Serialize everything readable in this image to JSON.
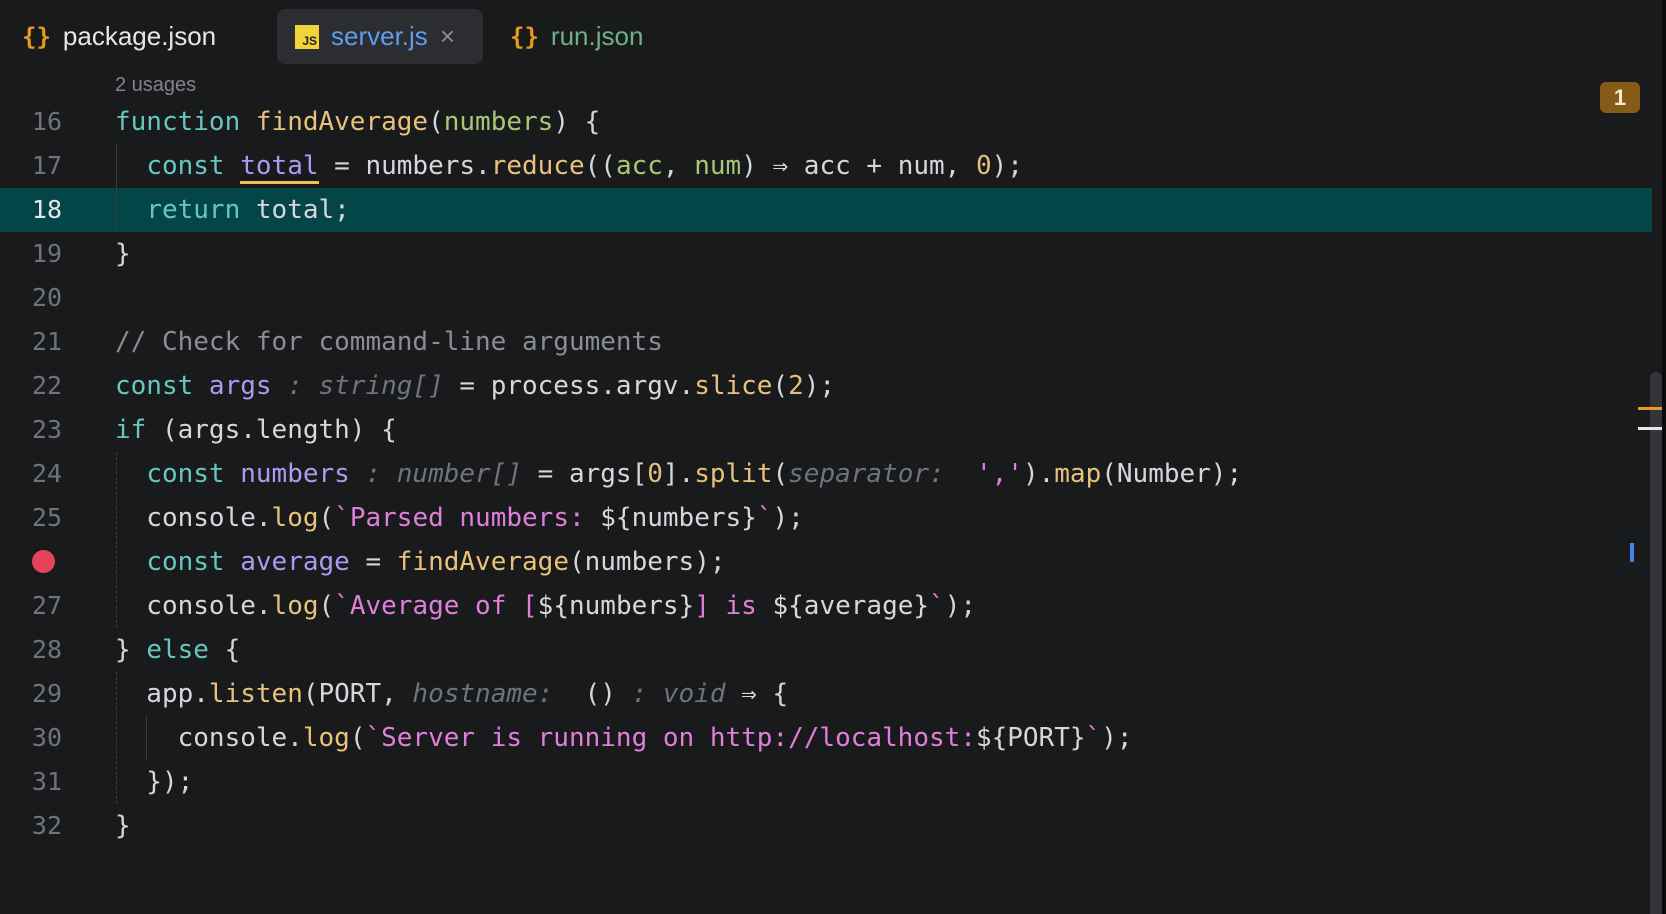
{
  "tabs": [
    {
      "label": "package.json",
      "icon": "json-braces-icon",
      "icon_text": "{}",
      "color": "#e4e6e8",
      "active": false
    },
    {
      "label": "server.js",
      "icon": "javascript-file-icon",
      "icon_text": "JS",
      "color": "#5f9cf0",
      "active": true,
      "close": "×"
    },
    {
      "label": "run.json",
      "icon": "json-braces-icon",
      "icon_text": "{}",
      "color": "#6fb08a",
      "active": false
    }
  ],
  "editor": {
    "usages_hint": "2 usages",
    "problems_badge": "1",
    "current_line": 18,
    "breakpoint_line": 26,
    "lines": [
      {
        "n": "16",
        "tokens": [
          [
            "k",
            "function "
          ],
          [
            "f",
            "findAverage"
          ],
          [
            "t",
            "("
          ],
          [
            "p",
            "numbers"
          ],
          [
            "t",
            ") {"
          ]
        ]
      },
      {
        "n": "17",
        "tokens": [
          [
            "t",
            "  "
          ],
          [
            "k",
            "const "
          ],
          [
            "v ul",
            "total"
          ],
          [
            "t",
            " = numbers."
          ],
          [
            "f",
            "reduce"
          ],
          [
            "t",
            "(("
          ],
          [
            "p",
            "acc"
          ],
          [
            "t",
            ", "
          ],
          [
            "p",
            "num"
          ],
          [
            "t",
            ") ⇒ acc + num, "
          ],
          [
            "n",
            "0"
          ],
          [
            "t",
            ");"
          ]
        ]
      },
      {
        "n": "18",
        "tokens": [
          [
            "t",
            "  "
          ],
          [
            "k",
            "return "
          ],
          [
            "t",
            "total;"
          ]
        ]
      },
      {
        "n": "19",
        "tokens": [
          [
            "t",
            "}"
          ]
        ]
      },
      {
        "n": "20",
        "tokens": []
      },
      {
        "n": "21",
        "tokens": [
          [
            "c",
            "// Check for command-line arguments"
          ]
        ]
      },
      {
        "n": "22",
        "tokens": [
          [
            "k",
            "const "
          ],
          [
            "v",
            "args"
          ],
          [
            "h",
            " : string[]"
          ],
          [
            "t",
            " = process.argv."
          ],
          [
            "f",
            "slice"
          ],
          [
            "t",
            "("
          ],
          [
            "n",
            "2"
          ],
          [
            "t",
            ");"
          ]
        ]
      },
      {
        "n": "23",
        "tokens": [
          [
            "k",
            "if "
          ],
          [
            "t",
            "(args.length) {"
          ]
        ]
      },
      {
        "n": "24",
        "tokens": [
          [
            "t",
            "  "
          ],
          [
            "k",
            "const "
          ],
          [
            "v",
            "numbers"
          ],
          [
            "h",
            " : number[]"
          ],
          [
            "t",
            " = args["
          ],
          [
            "n",
            "0"
          ],
          [
            "t",
            "]."
          ],
          [
            "f",
            "split"
          ],
          [
            "t",
            "("
          ],
          [
            "h",
            "separator: "
          ],
          [
            "t",
            " "
          ],
          [
            "s",
            "','"
          ],
          [
            "t",
            ")."
          ],
          [
            "f",
            "map"
          ],
          [
            "t",
            "(Number);"
          ]
        ]
      },
      {
        "n": "25",
        "tokens": [
          [
            "t",
            "  console."
          ],
          [
            "f",
            "log"
          ],
          [
            "t",
            "("
          ],
          [
            "s",
            "`Parsed numbers: "
          ],
          [
            "t",
            "${numbers}"
          ],
          [
            "s",
            "`"
          ],
          [
            "t",
            ");"
          ]
        ]
      },
      {
        "n": "",
        "tokens": [
          [
            "t",
            "  "
          ],
          [
            "k",
            "const "
          ],
          [
            "v",
            "average"
          ],
          [
            "t",
            " = "
          ],
          [
            "f",
            "findAverage"
          ],
          [
            "t",
            "(numbers);"
          ]
        ]
      },
      {
        "n": "27",
        "tokens": [
          [
            "t",
            "  console."
          ],
          [
            "f",
            "log"
          ],
          [
            "t",
            "("
          ],
          [
            "s",
            "`Average of ["
          ],
          [
            "t",
            "${numbers}"
          ],
          [
            "s",
            "] is "
          ],
          [
            "t",
            "${average}"
          ],
          [
            "s",
            "`"
          ],
          [
            "t",
            ");"
          ]
        ]
      },
      {
        "n": "28",
        "tokens": [
          [
            "t",
            "} "
          ],
          [
            "k",
            "else"
          ],
          [
            "t",
            " {"
          ]
        ]
      },
      {
        "n": "29",
        "tokens": [
          [
            "t",
            "  app."
          ],
          [
            "f",
            "listen"
          ],
          [
            "t",
            "(PORT, "
          ],
          [
            "h",
            "hostname: "
          ],
          [
            "t",
            " ()"
          ],
          [
            "h",
            " : void"
          ],
          [
            "t",
            " ⇒ {"
          ]
        ]
      },
      {
        "n": "30",
        "tokens": [
          [
            "t",
            "    console."
          ],
          [
            "f",
            "log"
          ],
          [
            "t",
            "("
          ],
          [
            "s",
            "`Server is running on http://localhost:"
          ],
          [
            "t",
            "${PORT}"
          ],
          [
            "s",
            "`"
          ],
          [
            "t",
            ");"
          ]
        ]
      },
      {
        "n": "31",
        "tokens": [
          [
            "t",
            "  });"
          ]
        ]
      },
      {
        "n": "32",
        "tokens": [
          [
            "t",
            "}"
          ]
        ]
      }
    ]
  }
}
